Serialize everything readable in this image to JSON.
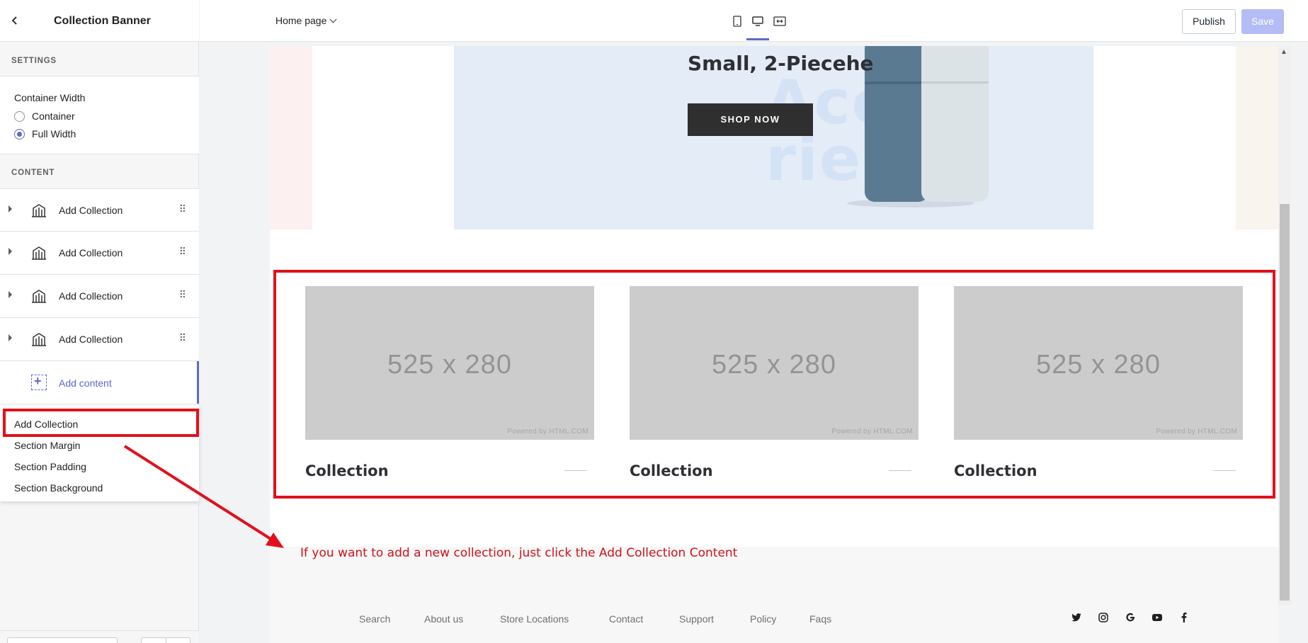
{
  "sidebar": {
    "title": "Collection Banner",
    "settings_label": "SETTINGS",
    "container_width_label": "Container Width",
    "options": [
      {
        "label": "Container",
        "selected": false
      },
      {
        "label": "Full Width",
        "selected": true
      }
    ],
    "content_label": "CONTENT",
    "items": [
      {
        "label": "Add Collection"
      },
      {
        "label": "Add Collection"
      },
      {
        "label": "Add Collection"
      },
      {
        "label": "Add Collection"
      }
    ],
    "add_content_label": "Add content",
    "dropdown": [
      "Add Collection",
      "Section Margin",
      "Section Padding",
      "Section Background"
    ]
  },
  "topbar": {
    "page_select": "Home page",
    "publish_label": "Publish",
    "save_label": "Save"
  },
  "banner": {
    "title": "Small, 2-Piecehe",
    "button_label": "SHOP NOW",
    "watermark_line1": "Acc   so",
    "watermark_line2": "ries"
  },
  "cards": [
    {
      "dimensions": "525 x 280",
      "powered": "Powered by HTML.COM",
      "title": "Collection"
    },
    {
      "dimensions": "525 x 280",
      "powered": "Powered by HTML.COM",
      "title": "Collection"
    },
    {
      "dimensions": "525 x 280",
      "powered": "Powered by HTML.COM",
      "title": "Collection"
    }
  ],
  "annotation": "If you want to add a new collection, just click the Add Collection Content",
  "footer": {
    "links": [
      "Search",
      "About us",
      "Store Locations",
      "Contact",
      "Support",
      "Policy",
      "Faqs"
    ],
    "social_icons": [
      "twitter-icon",
      "instagram-icon",
      "google-icon",
      "youtube-icon",
      "facebook-icon"
    ]
  },
  "colors": {
    "accent": "#5c6ac4",
    "annotation_red": "#e0111b",
    "placeholder_gray": "#cccccc",
    "save_disabled": "#b3bcf5"
  }
}
